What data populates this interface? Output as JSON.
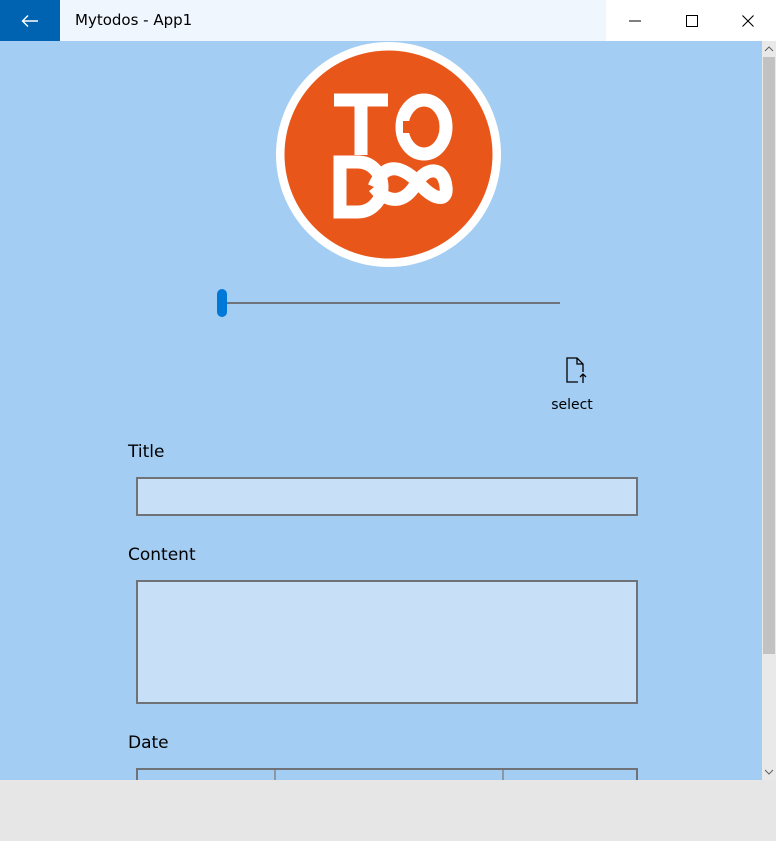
{
  "window": {
    "title": "Mytodos - App1"
  },
  "logo": {
    "text_top": "TO",
    "text_bottom": "DO",
    "color": "#e9561a"
  },
  "slider": {
    "value_fraction": 0.0
  },
  "select_button": {
    "label": "select",
    "icon": "file-upload-icon"
  },
  "form": {
    "title_label": "Title",
    "title_value": "",
    "content_label": "Content",
    "content_value": "",
    "date_label": "Date"
  },
  "colors": {
    "accent": "#0078d7",
    "back_button": "#0063b1",
    "page_background": "#a3cdf2",
    "input_background": "#c7e0f7"
  }
}
